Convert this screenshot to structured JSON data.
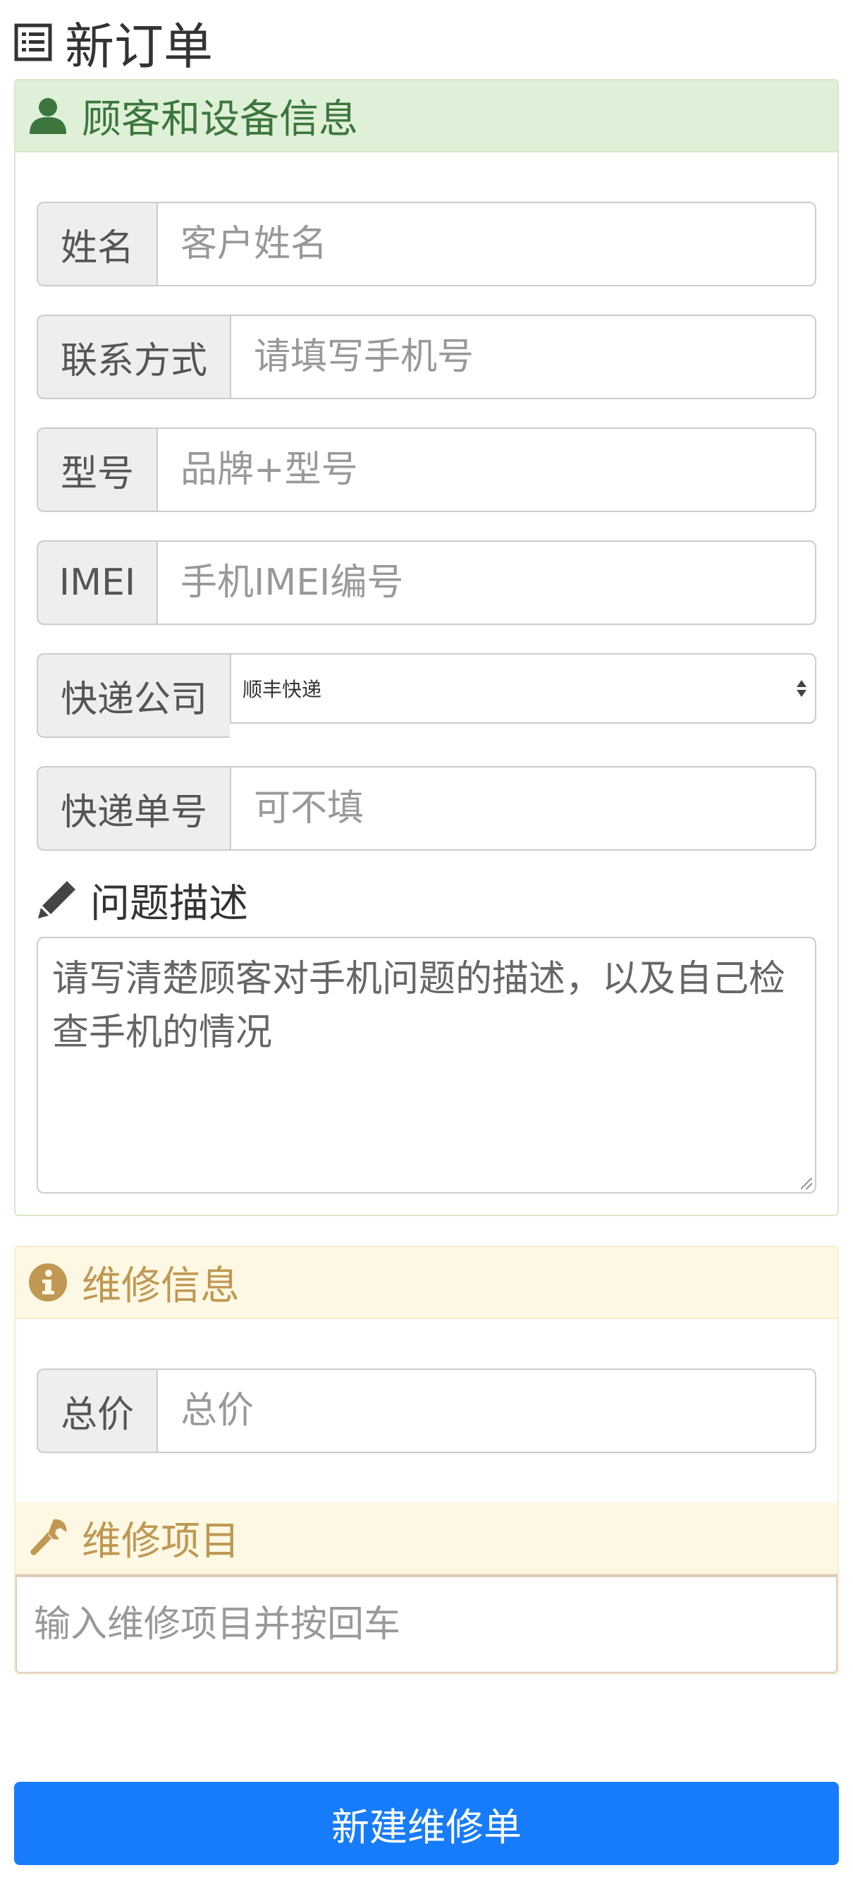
{
  "page_title": "新订单",
  "customer_panel": {
    "title": "顾客和设备信息",
    "fields": {
      "name": {
        "label": "姓名",
        "placeholder": "客户姓名"
      },
      "contact": {
        "label": "联系方式",
        "placeholder": "请填写手机号"
      },
      "model": {
        "label": "型号",
        "placeholder": "品牌+型号"
      },
      "imei": {
        "label": "IMEI",
        "placeholder": "手机IMEI编号"
      },
      "courier": {
        "label": "快递公司",
        "selected": "顺丰快递"
      },
      "tracking": {
        "label": "快递单号",
        "placeholder": "可不填"
      }
    },
    "description": {
      "label": "问题描述",
      "placeholder": "请写清楚顾客对手机问题的描述，以及自己检查手机的情况"
    }
  },
  "repair_panel": {
    "title": "维修信息",
    "total": {
      "label": "总价",
      "placeholder": "总价"
    },
    "items": {
      "title": "维修项目",
      "placeholder": "输入维修项目并按回车"
    }
  },
  "submit_label": "新建维修单",
  "colors": {
    "success_bg": "#dff0d8",
    "success_text": "#3c763d",
    "info_bg": "#fcf8e3",
    "info_text": "#c09853",
    "primary": "#167cfb"
  },
  "icons": {
    "title": "list-icon",
    "customer": "user-icon",
    "description": "pencil-icon",
    "repair": "info-circle-icon",
    "items": "wrench-icon"
  }
}
